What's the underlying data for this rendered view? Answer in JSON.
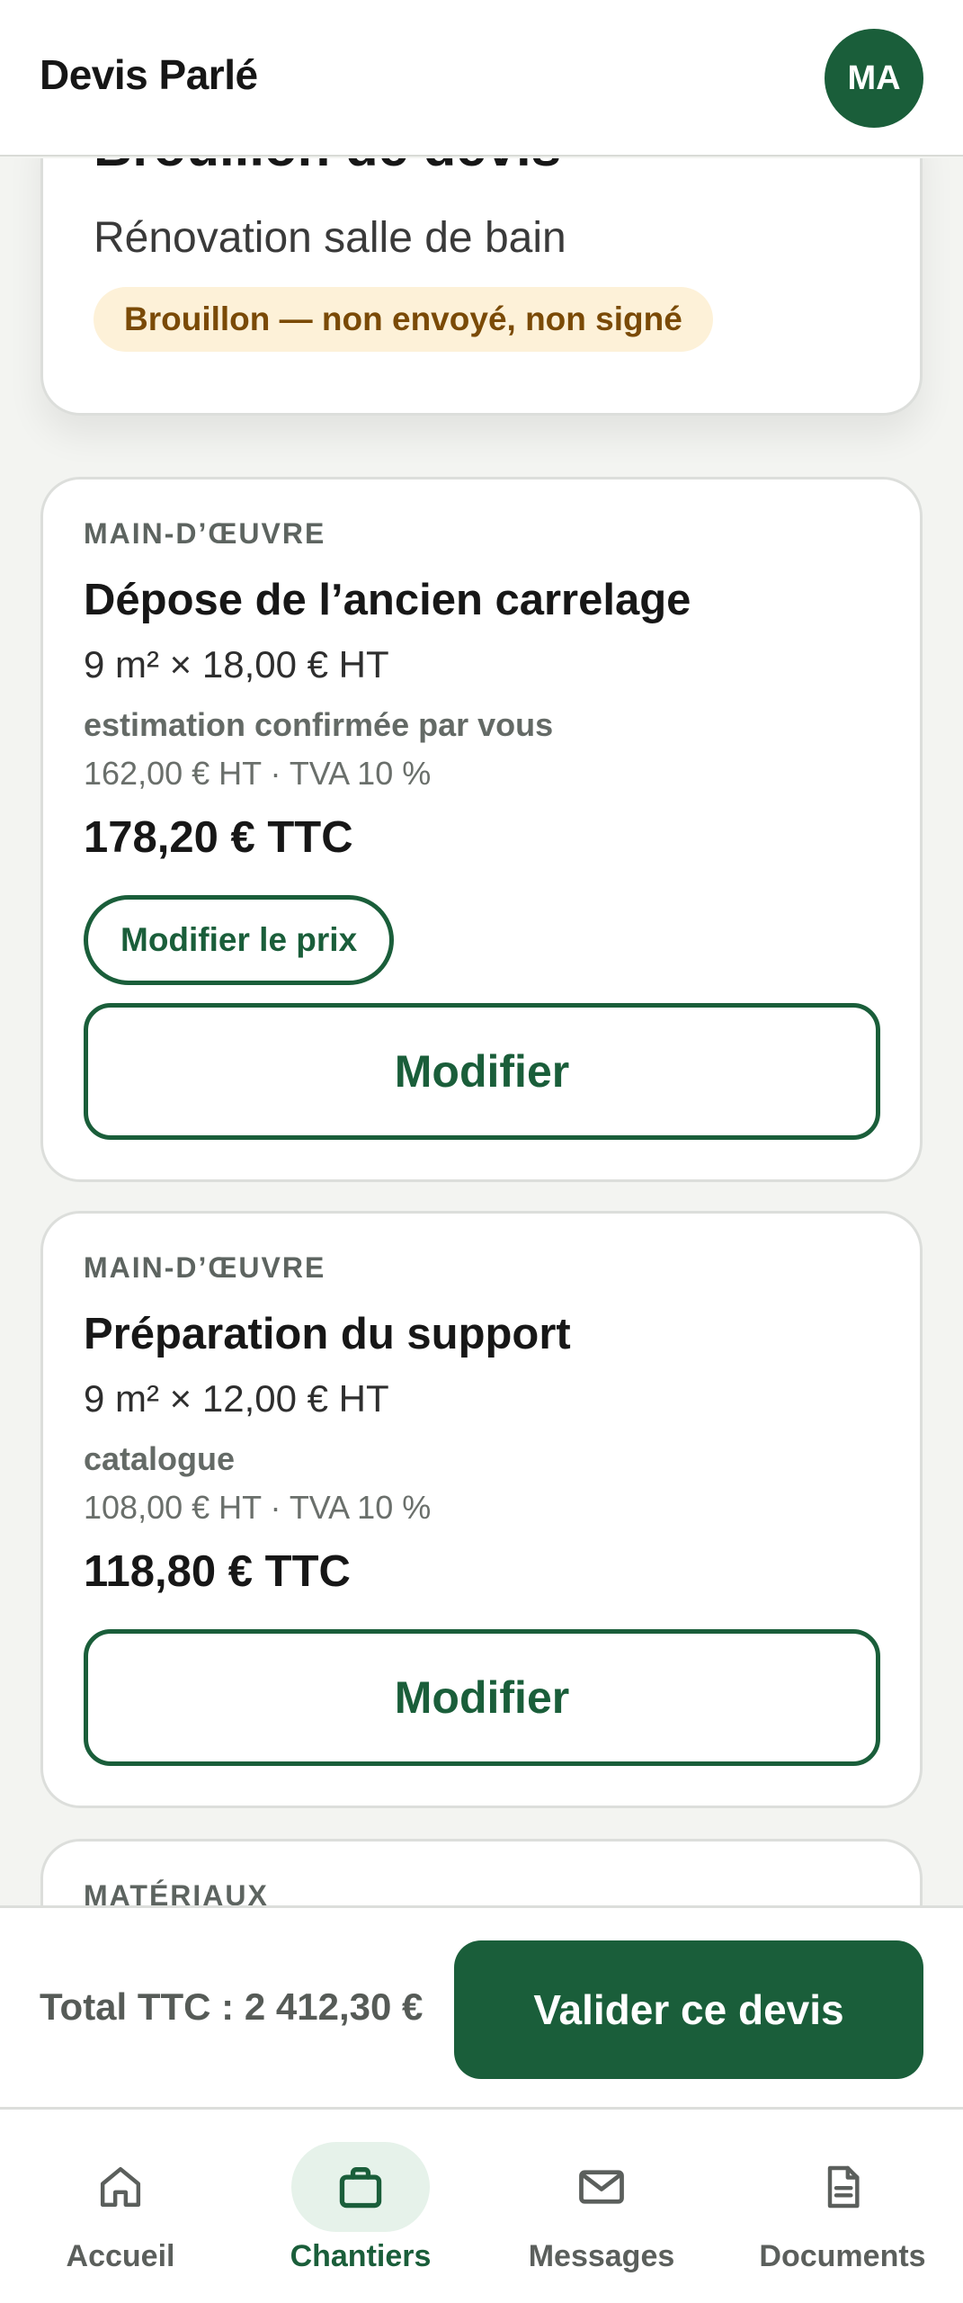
{
  "app": {
    "title": "Devis Parlé",
    "avatar_initials": "MA"
  },
  "quote": {
    "title": "Brouillon de devis",
    "subtitle": "Rénovation salle de bain",
    "status": "Brouillon — non envoyé, non signé"
  },
  "lines": [
    {
      "category": "MAIN-D’ŒUVRE",
      "title": "Dépose de l’ancien carrelage",
      "quantity_price": "9 m² × 18,00 € HT",
      "source": "estimation confirmée par vous",
      "ht_vat": "162,00 € HT · TVA 10 %",
      "ttc": "178,20 € TTC",
      "edit_price_label": "Modifier le prix",
      "edit_label": "Modifier"
    },
    {
      "category": "MAIN-D’ŒUVRE",
      "title": "Préparation du support",
      "quantity_price": "9 m² × 12,00 € HT",
      "source": "catalogue",
      "ht_vat": "108,00 € HT · TVA 10 %",
      "ttc": "118,80 € TTC",
      "edit_label": "Modifier"
    },
    {
      "category": "MATÉRIAUX"
    }
  ],
  "footer": {
    "total": "Total TTC : 2 412,30 €",
    "validate_label": "Valider ce devis"
  },
  "nav": {
    "items": [
      {
        "label": "Accueil",
        "icon": "home-icon"
      },
      {
        "label": "Chantiers",
        "icon": "briefcase-icon",
        "active": true
      },
      {
        "label": "Messages",
        "icon": "mail-icon"
      },
      {
        "label": "Documents",
        "icon": "document-icon"
      }
    ]
  },
  "colors": {
    "primary": "#1a5e3a",
    "badge_bg": "#fdf1d8",
    "badge_text": "#7a4a06",
    "nav_active_bg": "#e6f2ea"
  }
}
